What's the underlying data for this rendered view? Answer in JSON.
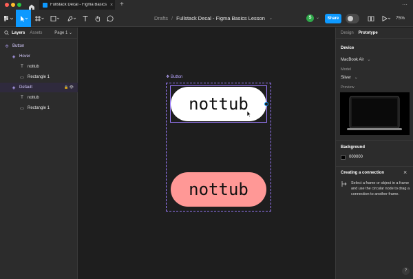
{
  "browser": {
    "tab_title": "Fullstack Decal - Figma Basics Les",
    "tab_close": "×",
    "new_tab": "+",
    "more": "···"
  },
  "toolbar": {
    "breadcrumb_root": "Drafts",
    "breadcrumb_sep": "/",
    "file_name": "Fullstack Decal - Figma Basics Lesson",
    "file_caret": "⌄",
    "avatar_initial": "S",
    "share_label": "Share",
    "zoom_label": "75%"
  },
  "left_panel": {
    "tabs": {
      "layers": "Layers",
      "assets": "Assets"
    },
    "page_label": "Page 1",
    "page_caret": "⌄",
    "layers": [
      {
        "label": "Button",
        "icon": "✣",
        "level": 0
      },
      {
        "label": "Hover",
        "icon": "◈",
        "level": 1
      },
      {
        "label": "nottub",
        "icon": "T",
        "level": 2
      },
      {
        "label": "Rectangle 1",
        "icon": "▭",
        "level": 2
      },
      {
        "label": "Default",
        "icon": "◈",
        "level": 1
      },
      {
        "label": "nottub",
        "icon": "T",
        "level": 2
      },
      {
        "label": "Rectangle 1",
        "icon": "▭",
        "level": 2
      }
    ]
  },
  "canvas": {
    "frame_label": "❖ Button",
    "button_text_1": "nottub",
    "button_text_2": "nottub",
    "colors": {
      "pill_default": "#ffffff",
      "pill_hover": "#ff9896",
      "selection": "#9b7bff"
    }
  },
  "right_panel": {
    "tabs": {
      "design": "Design",
      "prototype": "Prototype"
    },
    "device_heading": "Device",
    "device_value": "MacBook Air",
    "device_caret": "⌄",
    "model_label": "Model",
    "model_value": "Silver",
    "model_caret": "⌄",
    "preview_label": "Preview",
    "background_heading": "Background",
    "background_value": "000000",
    "connection_title": "Creating a connection",
    "connection_close": "×",
    "connection_text": "Select a frame or object in a frame and use the circular node to drag a connection to another frame.",
    "help": "?"
  }
}
